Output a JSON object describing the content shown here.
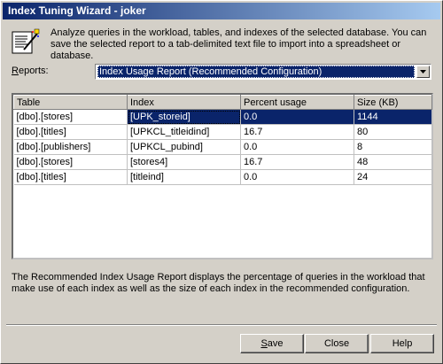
{
  "window": {
    "title": "Index Tuning Wizard - joker"
  },
  "description": "Analyze queries in the workload, tables, and indexes of the selected database. You can save the selected report to a tab-delimited text file to import into a spreadsheet or database.",
  "reports": {
    "label_accel": "R",
    "label_rest": "eports:",
    "selected": "Index Usage Report (Recommended Configuration)"
  },
  "table": {
    "columns": [
      "Table",
      "Index",
      "Percent usage",
      "Size (KB)"
    ],
    "rows": [
      [
        "[dbo].[stores]",
        "[UPK_storeid]",
        "0.0",
        "1144"
      ],
      [
        "[dbo].[titles]",
        "[UPKCL_titleidind]",
        "16.7",
        "80"
      ],
      [
        "[dbo].[publishers]",
        "[UPKCL_pubind]",
        "0.0",
        "8"
      ],
      [
        "[dbo].[stores]",
        "[stores4]",
        "16.7",
        "48"
      ],
      [
        "[dbo].[titles]",
        "[titleind]",
        "0.0",
        "24"
      ]
    ],
    "selected_row": 0
  },
  "footer_text": "The Recommended Index Usage Report displays the percentage of queries in the workload that make use of each index as well as the size of each index in the recommended configuration.",
  "buttons": {
    "save_accel": "S",
    "save_rest": "ave",
    "close": "Close",
    "help": "Help"
  },
  "colors": {
    "title_start": "#0a246a",
    "title_end": "#a6caf0",
    "selection": "#0a246a",
    "face": "#d4d0c8"
  }
}
